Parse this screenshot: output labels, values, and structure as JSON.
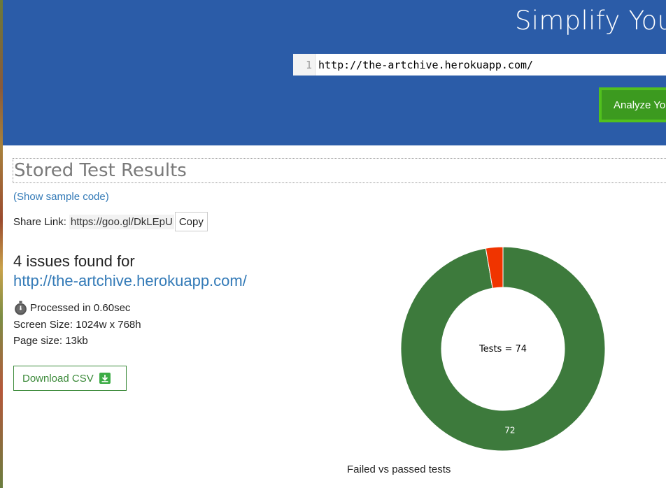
{
  "hero": {
    "title": "Simplify You",
    "editor_line_number": "1",
    "editor_url": "http://the-artchive.herokuapp.com/",
    "analyze_label": "Analyze Yo"
  },
  "results": {
    "section_title": "Stored Test Results",
    "sample_code_link": "(Show sample code)",
    "share_label": "Share Link:",
    "share_url": "https://goo.gl/DkLEpU",
    "copy_label": "Copy"
  },
  "summary": {
    "issues_heading": "4 issues found for",
    "tested_url": "http://the-artchive.herokuapp.com/",
    "processed": "Processed in 0.60sec",
    "screen_size": "Screen Size: 1024w x 768h",
    "page_size": "Page size: 13kb",
    "download_label": "Download CSV"
  },
  "icons": {
    "processed": "stopwatch-icon",
    "download": "download-arrow-icon"
  },
  "colors": {
    "hero_bg": "#2b5ca8",
    "analyze_btn": "#3c9a1f",
    "link": "#337ab7",
    "passed": "#3d7a3c",
    "failed": "#f03400"
  },
  "chart_data": {
    "type": "pie",
    "donut": true,
    "categories": [
      "Passed",
      "Failed"
    ],
    "values": [
      72,
      2
    ],
    "colors": [
      "#3d7a3c",
      "#f03400"
    ],
    "center_label": "Tests = 74",
    "data_labels": [
      "72",
      ""
    ],
    "caption": "Failed vs passed tests"
  }
}
